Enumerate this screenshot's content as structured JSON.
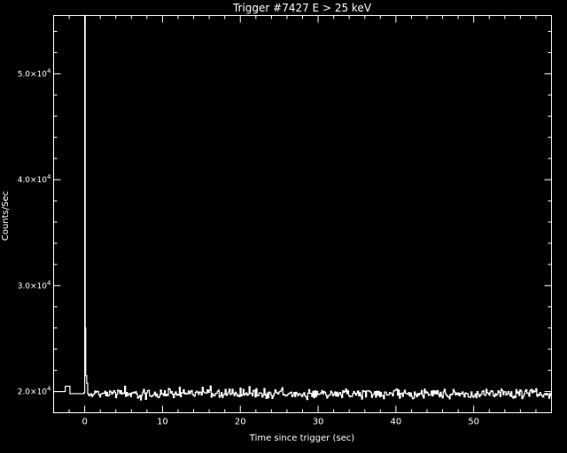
{
  "chart_data": {
    "type": "line",
    "title": "Trigger #7427  E > 25 keV",
    "xlabel": "Time since trigger (sec)",
    "ylabel": "Counts/Sec",
    "xlim": [
      -4,
      60
    ],
    "ylim": [
      18000,
      55500
    ],
    "x_ticks": [
      0,
      10,
      20,
      30,
      40,
      50
    ],
    "y_ticks": [
      {
        "value": 20000,
        "mantissa": "2.0",
        "exponent": "4"
      },
      {
        "value": 30000,
        "mantissa": "3.0",
        "exponent": "4"
      },
      {
        "value": 40000,
        "mantissa": "4.0",
        "exponent": "4"
      },
      {
        "value": 50000,
        "mantissa": "5.0",
        "exponent": "4"
      }
    ],
    "grid": false,
    "colors": {
      "background": "#000000",
      "foreground": "#ffffff"
    },
    "series": [
      {
        "background_level": 19800,
        "noise_amplitude": 500,
        "bin_width_sec": 0.128,
        "step_points": [
          {
            "x": -4.0,
            "y": 20000
          },
          {
            "x": -2.5,
            "y": 20500
          },
          {
            "x": -1.9,
            "y": 19800
          },
          {
            "x": -0.1,
            "y": 19900
          },
          {
            "x": 0.0,
            "y": 55500
          },
          {
            "x": 0.064,
            "y": 26000
          },
          {
            "x": 0.128,
            "y": 21500
          },
          {
            "x": 0.256,
            "y": 20800
          },
          {
            "x": 0.384,
            "y": 19800
          }
        ],
        "x_end": 60
      }
    ]
  }
}
